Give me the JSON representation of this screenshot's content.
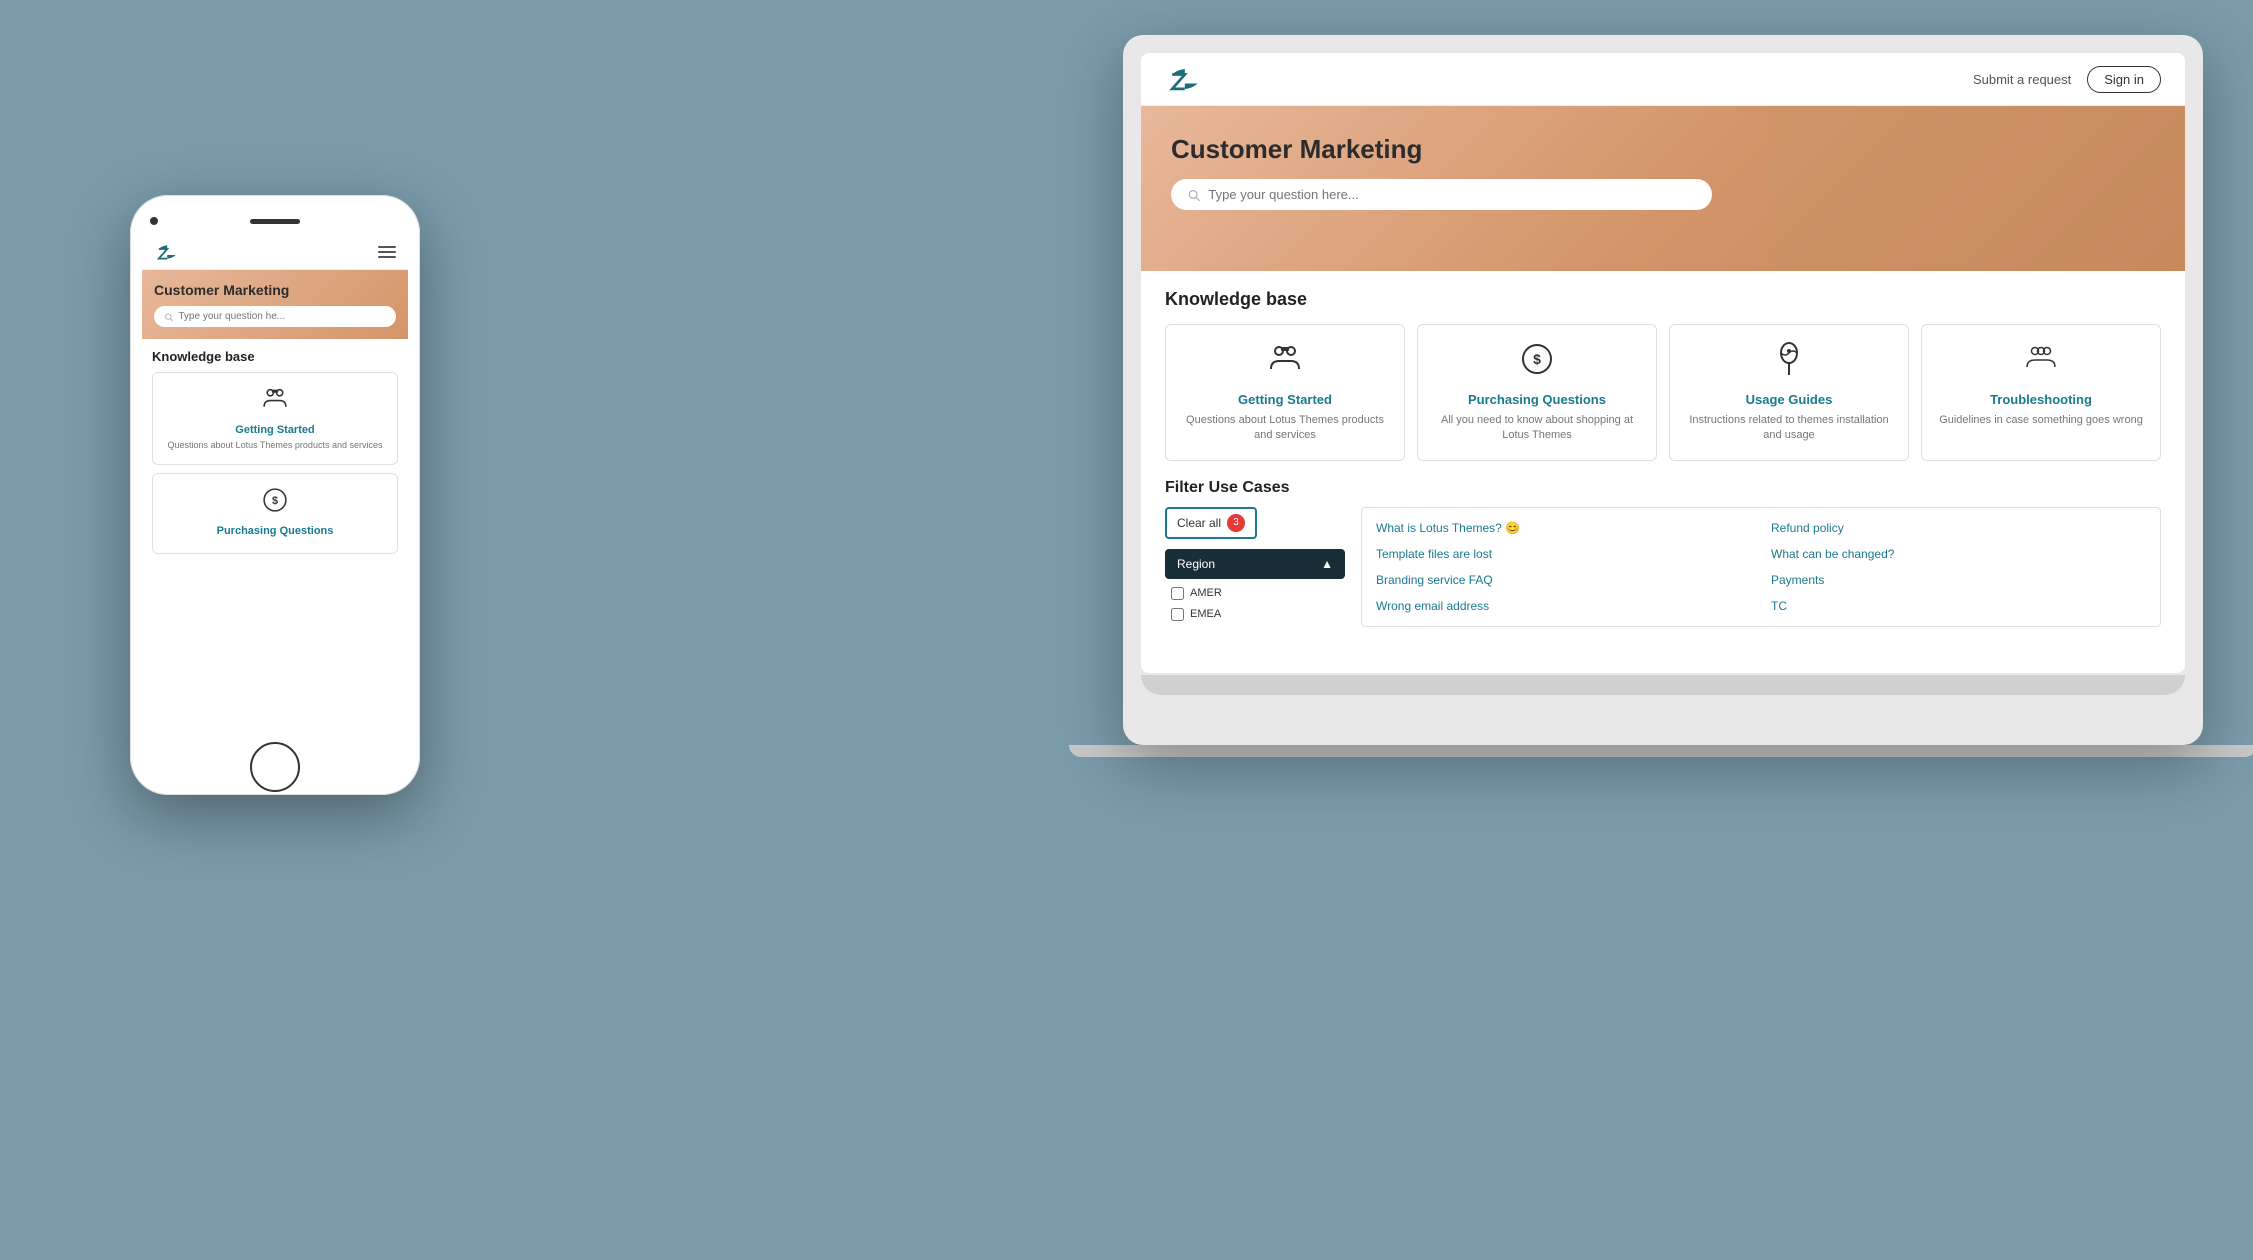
{
  "scene": {
    "background": "#7a9baa"
  },
  "laptop": {
    "header": {
      "submit_link": "Submit a request",
      "sign_in": "Sign in"
    },
    "hero": {
      "title": "Customer Marketing",
      "search_placeholder": "Type your question here..."
    },
    "knowledge_base": {
      "section_title": "Knowledge base",
      "cards": [
        {
          "id": "getting-started",
          "icon": "👤👤",
          "title": "Getting Started",
          "description": "Questions about Lotus Themes products and services"
        },
        {
          "id": "purchasing",
          "icon": "💰",
          "title": "Purchasing Questions",
          "description": "All you need to know about shopping at Lotus Themes"
        },
        {
          "id": "usage-guides",
          "icon": "🔑",
          "title": "Usage Guides",
          "description": "Instructions related to themes installation and usage"
        },
        {
          "id": "troubleshooting",
          "icon": "👥",
          "title": "Troubleshooting",
          "description": "Guidelines in case something goes wrong"
        }
      ]
    },
    "filter": {
      "section_title": "Filter Use Cases",
      "clear_all_label": "Clear all",
      "badge_count": "3",
      "region_label": "Region",
      "checkboxes": [
        "AMER",
        "EMEA"
      ],
      "results": [
        "What is Lotus Themes? 😊",
        "Refund policy",
        "Template files are lost",
        "What can be changed?",
        "Branding service FAQ",
        "Payments",
        "Wrong email address",
        "TC"
      ]
    }
  },
  "phone": {
    "hero": {
      "title": "Customer Marketing",
      "search_placeholder": "Type your question he..."
    },
    "knowledge_base": {
      "section_title": "Knowledge base",
      "cards": [
        {
          "id": "getting-started",
          "title": "Getting Started",
          "description": "Questions about Lotus Themes products and services"
        },
        {
          "id": "purchasing",
          "title": "Purchasing Questions",
          "description": ""
        }
      ]
    }
  }
}
